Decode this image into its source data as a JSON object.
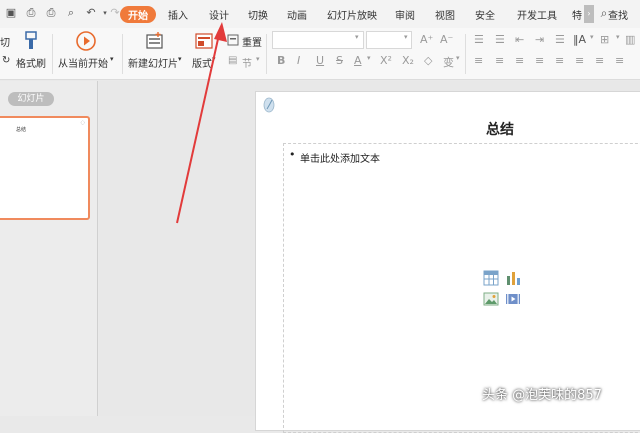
{
  "menubar": {
    "tabs": [
      {
        "label": "开始",
        "active": true
      },
      {
        "label": "插入"
      },
      {
        "label": "设计"
      },
      {
        "label": "切换"
      },
      {
        "label": "动画"
      },
      {
        "label": "幻灯片放映"
      },
      {
        "label": "审阅"
      },
      {
        "label": "视图"
      },
      {
        "label": "安全"
      },
      {
        "label": "开发工具"
      },
      {
        "label": "特"
      }
    ],
    "search_label": "查找"
  },
  "ribbon": {
    "paste_partial": "切",
    "format_painter": "格式刷",
    "play_from_current": "从当前开始",
    "new_slide": "新建幻灯片",
    "layout": "版式",
    "reset": "重置",
    "section": "节"
  },
  "left_panel": {
    "pill_label": "幻灯片",
    "thumb_title": "总结"
  },
  "slide": {
    "title": "总结",
    "bullet": "•",
    "content_placeholder": "单击此处添加文本"
  },
  "watermark": "头条 @泡芙味的857",
  "colors": {
    "accent": "#f07a3b",
    "arrow": "#e23b3b"
  }
}
